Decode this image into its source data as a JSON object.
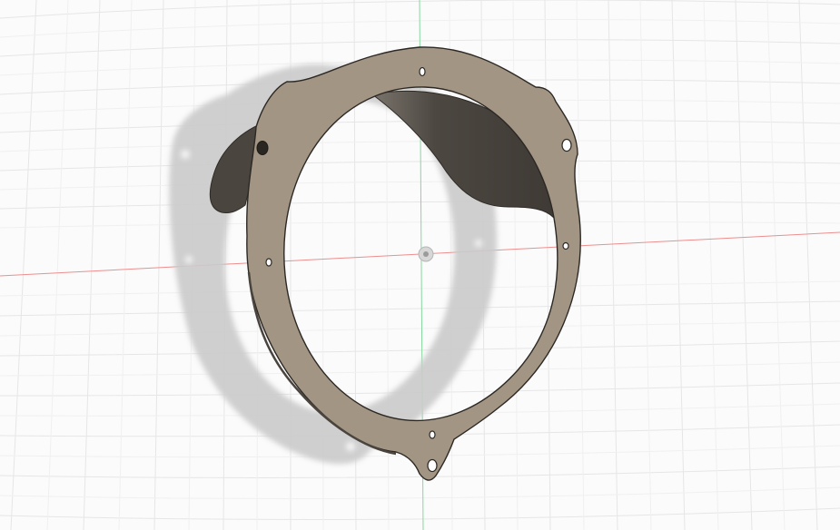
{
  "viewport": {
    "background": "#fbfbfb",
    "grid_color": "#e3e3e3",
    "x_axis_color": "#e88a8a",
    "y_axis_color": "#7fd39a"
  },
  "part": {
    "face_color": "#9f9281",
    "edge_color": "#2f2a25",
    "inner_wall_color": "#4b4640",
    "shadow_color": "#c9c9c9",
    "hole_count": 7
  },
  "origin_marker": "origin-icon"
}
